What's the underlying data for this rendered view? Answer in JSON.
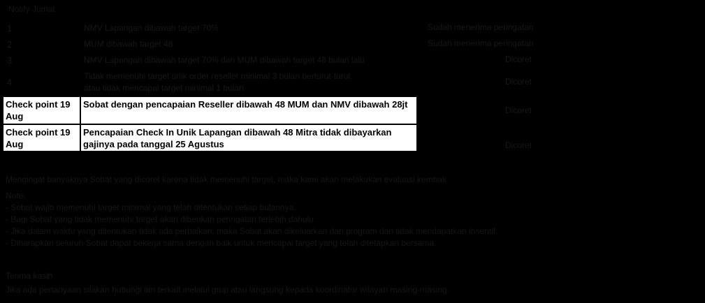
{
  "heading": "Notify Jumat",
  "table": {
    "rows": [
      {
        "number": "1",
        "description": "NMV Lapangan dibawah target 70%",
        "note": "Sudah menerima peringatan"
      },
      {
        "number": "2",
        "description": "MUM dibawah target 48",
        "note": "Sudah menerima peringatan"
      },
      {
        "number": "3",
        "description": "NMV Lapangan dibawah target 70% dan MUM dibawah target 48 bulan lalu",
        "note": "Dicoret"
      },
      {
        "number": "4",
        "description": "Tidak memenuhi target unik order reseller minimal 3 bulan berturut-turut",
        "description_line2": "atau tidak mencapai target minimal 1 bulan",
        "note": "Dicoret"
      }
    ],
    "highlighted": [
      {
        "label": "Check point 19 Aug",
        "description": "Sobat dengan pencapaian Reseller dibawah 48 MUM dan NMV dibawah 28jt",
        "note": "Dicoret"
      },
      {
        "label": "Check point 19 Aug",
        "description": "Pencapaian Check In Unik Lapangan dibawah 48 Mitra tidak dibayarkan gajinya pada tanggal 25 Agustus",
        "note": "Dicoret"
      }
    ]
  },
  "paragraphs": {
    "intro": "Mengingat banyaknya Sobat yang dicoret karena tidak memenuhi target, maka kami akan melakukan evaluasi kembali.",
    "notes_title": "Note:",
    "notes": [
      "- Sobat wajib memenuhi target minimal yang telah ditentukan setiap bulannya.",
      "- Bagi Sobat yang tidak memenuhi target akan diberikan peringatan terlebih dahulu.",
      "- Jika dalam waktu yang ditentukan tidak ada perbaikan, maka Sobat akan dikeluarkan dari program dan tidak mendapatkan insentif.",
      "- Diharapkan seluruh Sobat dapat bekerja sama dengan baik untuk mencapai target yang telah ditetapkan bersama."
    ],
    "closing_title": "Terima kasih",
    "closing": "Jika ada pertanyaan silakan hubungi tim terkait melalui grup atau langsung kepada koordinator wilayah masing-masing."
  }
}
